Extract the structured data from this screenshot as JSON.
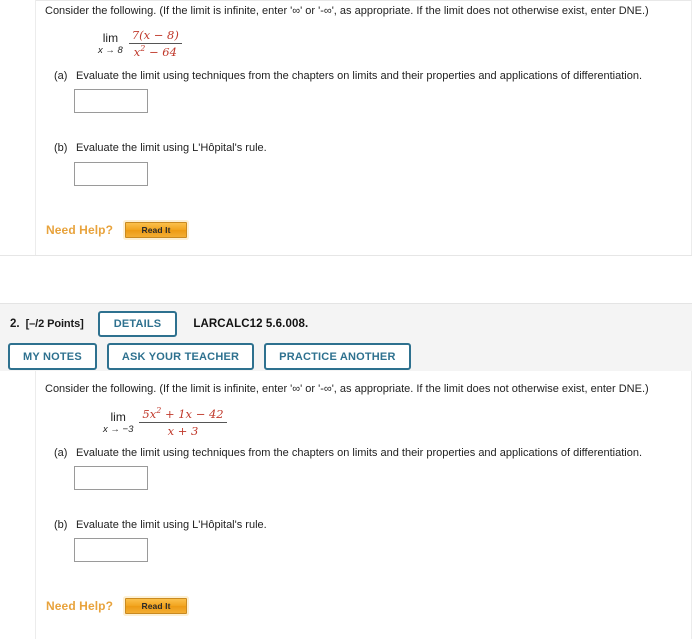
{
  "page": {
    "background": "#ffffff",
    "accent_blue": "#2e718f",
    "accent_orange": "#e8a33d",
    "math_color": "#c0392b"
  },
  "problems": [
    {
      "id": "problem-1",
      "has_header": false,
      "prompt": "Consider the following. (If the limit is infinite, enter '∞' or '-∞', as appropriate. If the limit does not otherwise exist, enter DNE.)",
      "math": {
        "lim_label": "lim",
        "lim_subscript": "x → 8",
        "numerator": "7(x − 8)",
        "denominator": "x² − 64",
        "denom_base": "x",
        "denom_exponent": "2",
        "denom_rest": " − 64"
      },
      "parts": [
        {
          "label": "(a)",
          "text": "Evaluate the limit using techniques from the chapters on limits and their properties and applications of differentiation.",
          "answer_value": "",
          "answer_placeholder": ""
        },
        {
          "label": "(b)",
          "text": "Evaluate the limit using L'Hôpital's rule.",
          "answer_value": "",
          "answer_placeholder": ""
        }
      ],
      "need_help": {
        "label": "Need Help?",
        "read_it_label": "Read It"
      }
    },
    {
      "id": "problem-2",
      "has_header": true,
      "header": {
        "number": "2.",
        "points": "[–/2 Points]",
        "details_label": "DETAILS",
        "code": "LARCALC12 5.6.008.",
        "my_notes_label": "MY NOTES",
        "ask_teacher_label": "ASK YOUR TEACHER",
        "practice_another_label": "PRACTICE ANOTHER"
      },
      "prompt": "Consider the following. (If the limit is infinite, enter '∞' or '-∞', as appropriate. If the limit does not otherwise exist, enter DNE.)",
      "math": {
        "lim_label": "lim",
        "lim_subscript": "x → −3",
        "numerator": "5x² + 1x − 42",
        "denominator": "x + 3",
        "num_lead": "5",
        "num_base": "x",
        "num_exponent": "2",
        "num_rest": " + 1x − 42"
      },
      "parts": [
        {
          "label": "(a)",
          "text": "Evaluate the limit using techniques from the chapters on limits and their properties and applications of differentiation.",
          "answer_value": "",
          "answer_placeholder": ""
        },
        {
          "label": "(b)",
          "text": "Evaluate the limit using L'Hôpital's rule.",
          "answer_value": "",
          "answer_placeholder": ""
        }
      ],
      "need_help": {
        "label": "Need Help?",
        "read_it_label": "Read It"
      }
    }
  ]
}
